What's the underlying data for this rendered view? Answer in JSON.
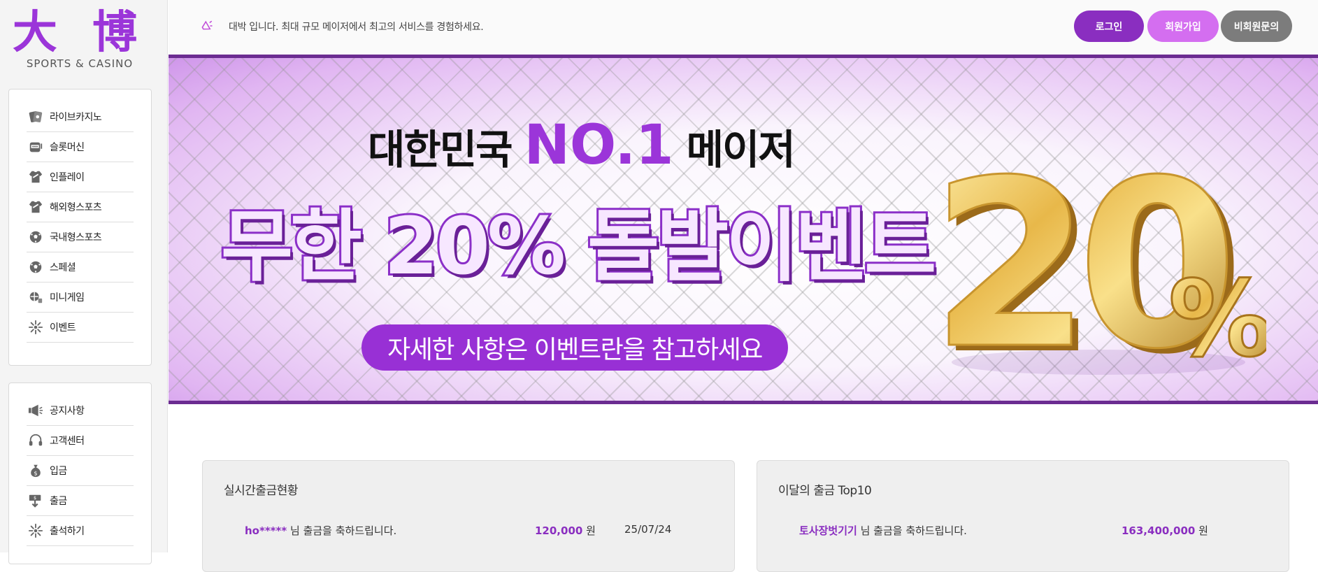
{
  "logo": {
    "main": "大 博",
    "sub": "SPORTS & CASINO"
  },
  "menu_games": [
    {
      "label": "라이브카지노",
      "icon": "cards-icon"
    },
    {
      "label": "슬롯머신",
      "icon": "slot-machine-icon"
    },
    {
      "label": "인플레이",
      "icon": "jersey-icon"
    },
    {
      "label": "해외형스포츠",
      "icon": "jersey-icon"
    },
    {
      "label": "국내형스포츠",
      "icon": "soccer-ball-icon"
    },
    {
      "label": "스페셜",
      "icon": "soccer-ball-icon"
    },
    {
      "label": "미니게임",
      "icon": "minigame-icon"
    },
    {
      "label": "이벤트",
      "icon": "sparkle-icon"
    }
  ],
  "menu_support": [
    {
      "label": "공지사항",
      "icon": "megaphone-icon"
    },
    {
      "label": "고객센터",
      "icon": "headset-icon"
    },
    {
      "label": "입금",
      "icon": "money-bag-icon"
    },
    {
      "label": "출금",
      "icon": "withdraw-icon"
    },
    {
      "label": "출석하기",
      "icon": "sparkle-icon"
    }
  ],
  "topbar": {
    "notice": "대박 입니다. 최대 규모 메이저에서 최고의 서비스를 경험하세요.",
    "login": "로그인",
    "join": "회원가입",
    "guest_inquiry": "비회원문의"
  },
  "banner": {
    "head_pre": "대한민국",
    "head_accent": "NO.1",
    "head_post": "메이저",
    "big": "무한 20% 돌발이벤트",
    "pill": "자세한 사항은 이벤트란을 참고하세요",
    "gold_number": "20",
    "gold_percent": "%"
  },
  "realtime": {
    "title": "실시간출금현황",
    "row": {
      "name": "ho*****",
      "msg": "님 출금을 축하드립니다.",
      "amount": "120,000",
      "unit": "원",
      "date": "25/07/24"
    }
  },
  "top10": {
    "title": "이달의 출금 Top10",
    "row": {
      "name": "토사장벗기기",
      "msg": "님 출금을 축하드립니다.",
      "amount": "163,400,000",
      "unit": "원"
    }
  },
  "colors": {
    "brand": "#8a2ec0",
    "accent_light": "#d46ef0",
    "gray_button": "#7c7c7c",
    "banner_border": "#6b2c91"
  }
}
